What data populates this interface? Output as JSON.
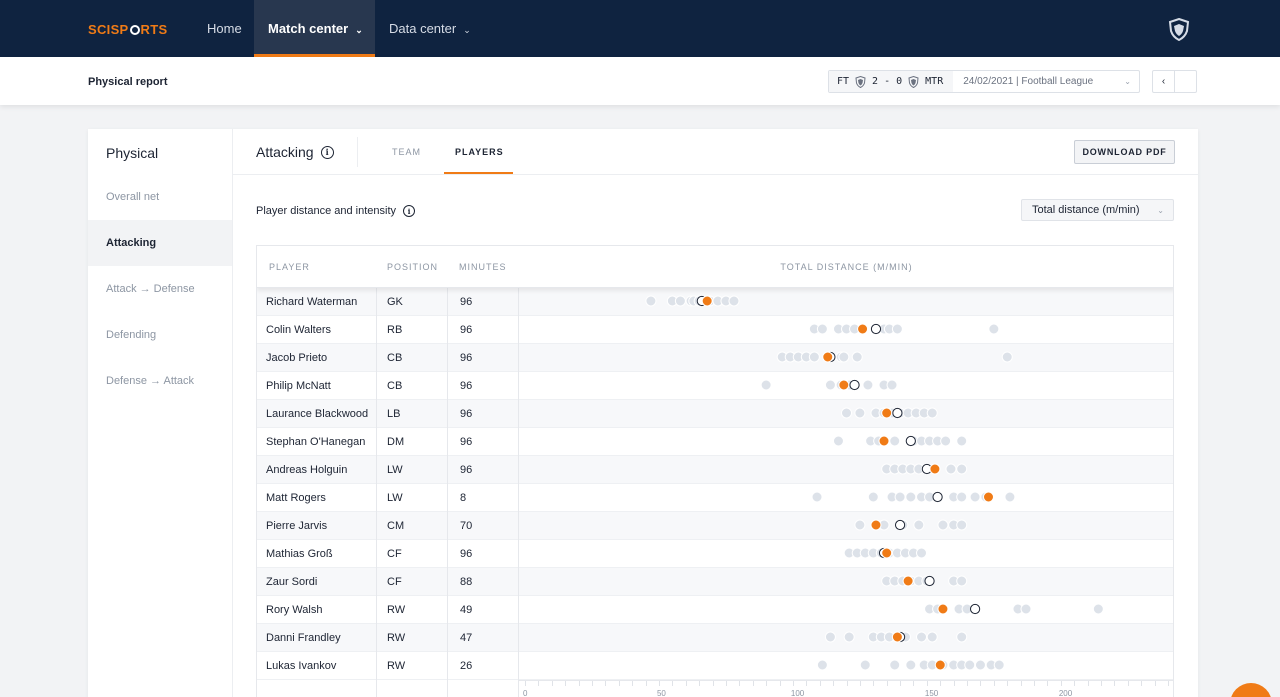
{
  "app": {
    "logo": "SCISPORTS"
  },
  "nav": {
    "home": "Home",
    "match_center": "Match center",
    "data_center": "Data center"
  },
  "subbar": {
    "title": "Physical report",
    "match": {
      "status": "FT",
      "score": "2 - 0",
      "away": "MTR",
      "date_league": "24/02/2021 | Football League"
    },
    "prev": "‹"
  },
  "sidebar": {
    "title": "Physical",
    "items": [
      {
        "label": "Overall net",
        "active": false
      },
      {
        "label": "Attacking",
        "active": true
      },
      {
        "label": "Attack → Defense",
        "active": false
      },
      {
        "label": "Defending",
        "active": false
      },
      {
        "label": "Defense → Attack",
        "active": false
      }
    ]
  },
  "section": {
    "title": "Attacking",
    "tabs": [
      "TEAM",
      "PLAYERS"
    ],
    "active_tab": "PLAYERS",
    "download": "DOWNLOAD PDF",
    "subheading": "Player distance and intensity",
    "metric": "Total distance (m/min)"
  },
  "table": {
    "headers": [
      "PLAYER",
      "POSITION",
      "MINUTES",
      "TOTAL DISTANCE (M/MIN)"
    ],
    "axis_ticks": [
      "0",
      "50",
      "100",
      "150",
      "200"
    ],
    "rows": [
      {
        "player": "Richard Waterman",
        "position": "GK",
        "minutes": "96"
      },
      {
        "player": "Colin Walters",
        "position": "RB",
        "minutes": "96"
      },
      {
        "player": "Jacob Prieto",
        "position": "CB",
        "minutes": "96"
      },
      {
        "player": "Philip McNatt",
        "position": "CB",
        "minutes": "96"
      },
      {
        "player": "Laurance Blackwood",
        "position": "LB",
        "minutes": "96"
      },
      {
        "player": "Stephan O'Hanegan",
        "position": "DM",
        "minutes": "96"
      },
      {
        "player": "Andreas Holguin",
        "position": "LW",
        "minutes": "96"
      },
      {
        "player": "Matt Rogers",
        "position": "LW",
        "minutes": "8"
      },
      {
        "player": "Pierre Jarvis",
        "position": "CM",
        "minutes": "70"
      },
      {
        "player": "Mathias Groß",
        "position": "CF",
        "minutes": "96"
      },
      {
        "player": "Zaur Sordi",
        "position": "CF",
        "minutes": "88"
      },
      {
        "player": "Rory Walsh",
        "position": "RW",
        "minutes": "49"
      },
      {
        "player": "Danni Frandley",
        "position": "RW",
        "minutes": "47"
      },
      {
        "player": "Lukas Ivankov",
        "position": "RW",
        "minutes": "26"
      }
    ]
  },
  "chart_data": {
    "type": "scatter",
    "title": "TOTAL DISTANCE (M/MIN)",
    "xlim": [
      0,
      240
    ],
    "xticks": [
      0,
      50,
      100,
      150,
      200
    ],
    "series_colors": {
      "other_matches": "#dde2e9",
      "current": "#f07b16",
      "average": "#ffffff"
    },
    "players": [
      {
        "name": "Richard Waterman",
        "other": [
          47,
          55,
          58,
          62,
          63,
          65,
          69,
          72,
          75,
          78
        ],
        "average": 66,
        "current": 68
      },
      {
        "name": "Colin Walters",
        "other": [
          108,
          111,
          117,
          120,
          123,
          131,
          134,
          136,
          139,
          175
        ],
        "average": 131,
        "current": 126
      },
      {
        "name": "Jacob Prieto",
        "other": [
          96,
          99,
          102,
          105,
          108,
          114,
          118,
          119,
          124,
          180
        ],
        "average": 114,
        "current": 113
      },
      {
        "name": "Philip McNatt",
        "other": [
          90,
          114,
          118,
          121,
          128,
          134,
          137
        ],
        "average": 123,
        "current": 119
      },
      {
        "name": "Laurance Blackwood",
        "other": [
          120,
          125,
          131,
          134,
          137,
          140,
          143,
          146,
          149,
          152
        ],
        "average": 139,
        "current": 135
      },
      {
        "name": "Stephan O'Hanegan",
        "other": [
          117,
          129,
          132,
          138,
          145,
          148,
          151,
          154,
          157,
          163
        ],
        "average": 144,
        "current": 134
      },
      {
        "name": "Andreas Holguin",
        "other": [
          135,
          138,
          141,
          144,
          147,
          150,
          153,
          159,
          163
        ],
        "average": 150,
        "current": 153
      },
      {
        "name": "Matt Rogers",
        "other": [
          109,
          130,
          137,
          140,
          144,
          148,
          151,
          160,
          163,
          168,
          172,
          181
        ],
        "average": 154,
        "current": 173
      },
      {
        "name": "Pierre Jarvis",
        "other": [
          125,
          131,
          134,
          141,
          147,
          156,
          160,
          163
        ],
        "average": 140,
        "current": 131
      },
      {
        "name": "Mathias Groß",
        "other": [
          121,
          124,
          127,
          130,
          133,
          136,
          139,
          142,
          145,
          148
        ],
        "average": 134,
        "current": 135
      },
      {
        "name": "Zaur Sordi",
        "other": [
          135,
          138,
          141,
          144,
          147,
          150,
          160,
          163
        ],
        "average": 151,
        "current": 143
      },
      {
        "name": "Rory Walsh",
        "other": [
          151,
          154,
          162,
          165,
          184,
          187,
          214
        ],
        "average": 168,
        "current": 156
      },
      {
        "name": "Danni Frandley",
        "other": [
          114,
          121,
          130,
          133,
          136,
          139,
          142,
          148,
          152,
          163
        ],
        "average": 140,
        "current": 139
      },
      {
        "name": "Lukas Ivankov",
        "other": [
          111,
          127,
          138,
          144,
          149,
          152,
          156,
          160,
          163,
          166,
          170,
          174,
          177
        ],
        "average": 155,
        "current": 155
      }
    ]
  }
}
